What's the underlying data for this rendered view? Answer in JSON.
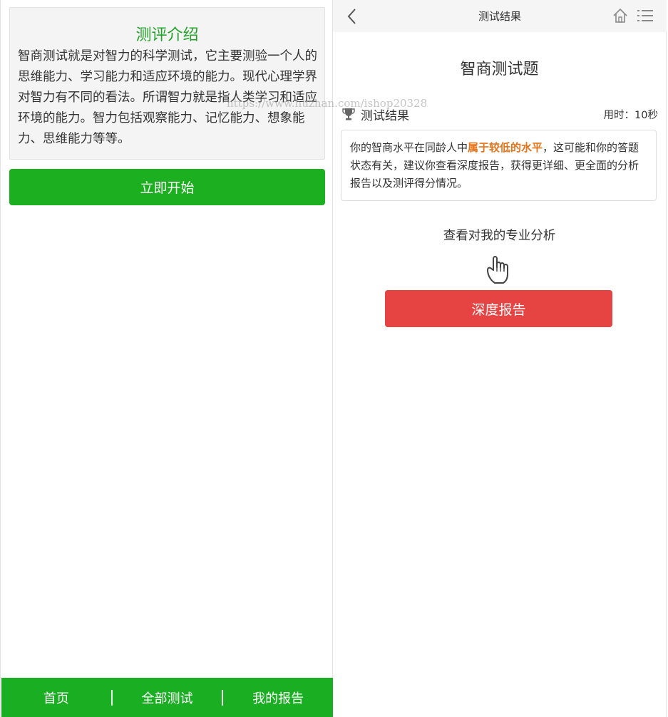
{
  "left": {
    "intro_title": "测评介绍",
    "intro_body": "智商测试就是对智力的科学测试，它主要测验一个人的思维能力、学习能力和适应环境的能力。现代心理学界对智力有不同的看法。所谓智力就是指人类学习和适应环境的能力。智力包括观察能力、记忆能力、想象能力、思维能力等等。",
    "start_button": "立即开始",
    "tabs": [
      {
        "label": "首页"
      },
      {
        "label": "全部测试"
      },
      {
        "label": "我的报告"
      }
    ]
  },
  "right": {
    "topbar_title": "测试结果",
    "quiz_title": "智商测试题",
    "result_label": "测试结果",
    "time_text": "用时：10秒",
    "result_text_before": "你的智商水平在同龄人中",
    "result_highlight": "属于较低的水平",
    "result_text_after": "，这可能和你的答题状态有关，建议你查看深度报告，获得更详细、更全面的分析报告以及测评得分情况。",
    "analysis_text": "查看对我的专业分析",
    "report_button": "深度报告"
  },
  "watermark": "https://www.huzhan.com/ishop20328",
  "icons": {
    "back": "chevron-left-icon",
    "home": "home-icon",
    "menu": "list-menu-icon",
    "trophy": "trophy-icon",
    "hand": "pointing-hand-icon"
  },
  "colors": {
    "green": "#1caf20",
    "intro_title_green": "#23a22a",
    "red": "#e64343",
    "highlight_orange": "#e5731a"
  }
}
